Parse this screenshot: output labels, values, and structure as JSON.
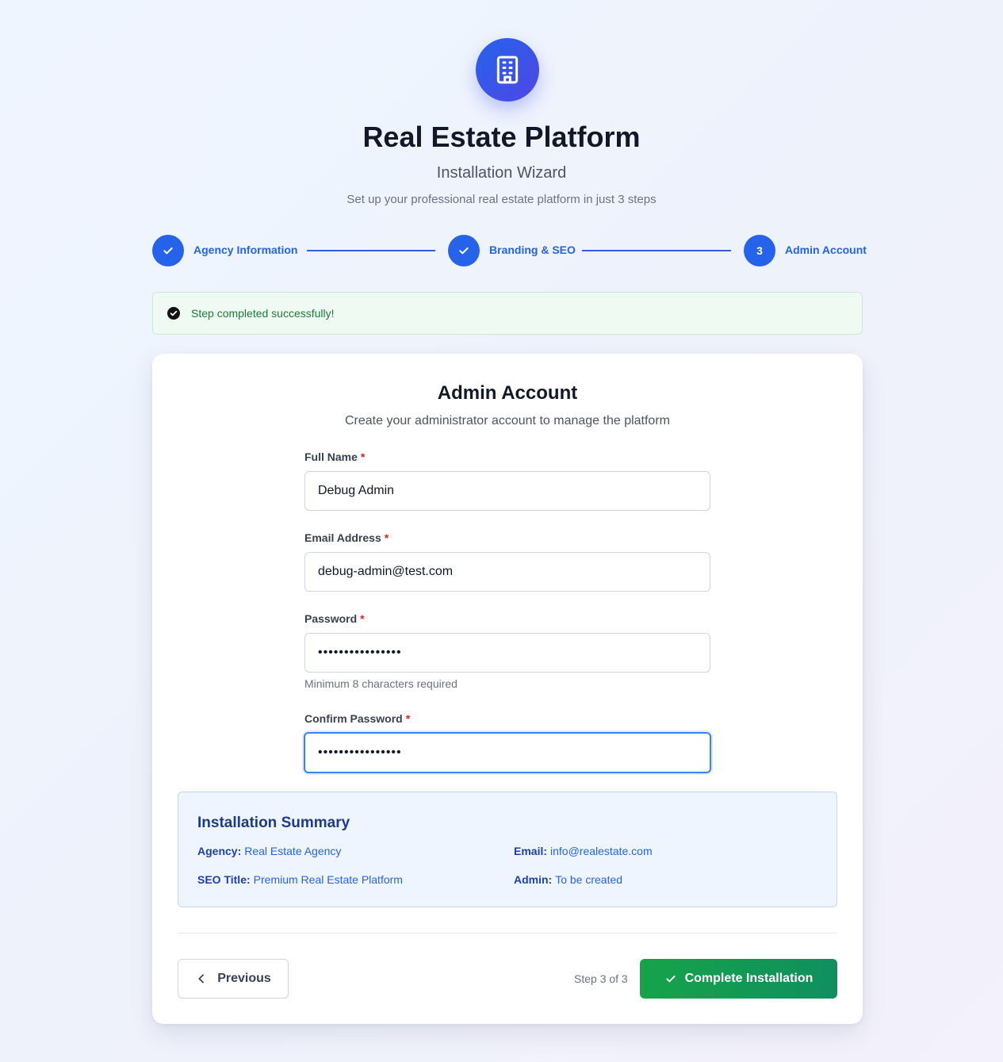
{
  "header": {
    "title": "Real Estate Platform",
    "subtitle": "Installation Wizard",
    "tagline": "Set up your professional real estate platform in just 3 steps",
    "logo_icon": "building-icon"
  },
  "steps": [
    {
      "label": "Agency Information",
      "status": "completed",
      "icon": "check-icon"
    },
    {
      "label": "Branding & SEO",
      "status": "completed",
      "icon": "check-icon"
    },
    {
      "label": "Admin Account",
      "status": "current",
      "number": "3"
    }
  ],
  "alert": {
    "text": "Step completed successfully!",
    "icon": "check-circle-icon"
  },
  "form": {
    "title": "Admin Account",
    "description": "Create your administrator account to manage the platform",
    "required_marker": "*",
    "full_name": {
      "label": "Full Name",
      "value": "Debug Admin"
    },
    "email": {
      "label": "Email Address",
      "value": "debug-admin@test.com"
    },
    "password": {
      "label": "Password",
      "value": "debugpassword123",
      "hint": "Minimum 8 characters required"
    },
    "confirm_password": {
      "label": "Confirm Password",
      "value": "debugpassword123"
    }
  },
  "summary": {
    "title": "Installation Summary",
    "agency_key": "Agency:",
    "agency_value": "Real Estate Agency",
    "email_key": "Email:",
    "email_value": "info@realestate.com",
    "seo_key": "SEO Title:",
    "seo_value": "Premium Real Estate Platform",
    "admin_key": "Admin:",
    "admin_value": "To be created"
  },
  "footer": {
    "previous_label": "Previous",
    "step_count": "Step 3 of 3",
    "complete_label": "Complete Installation"
  },
  "colors": {
    "primary": "#2563eb",
    "success": "#16a34a",
    "alert_bg": "#effbf2",
    "summary_bg": "#eef5ff"
  }
}
